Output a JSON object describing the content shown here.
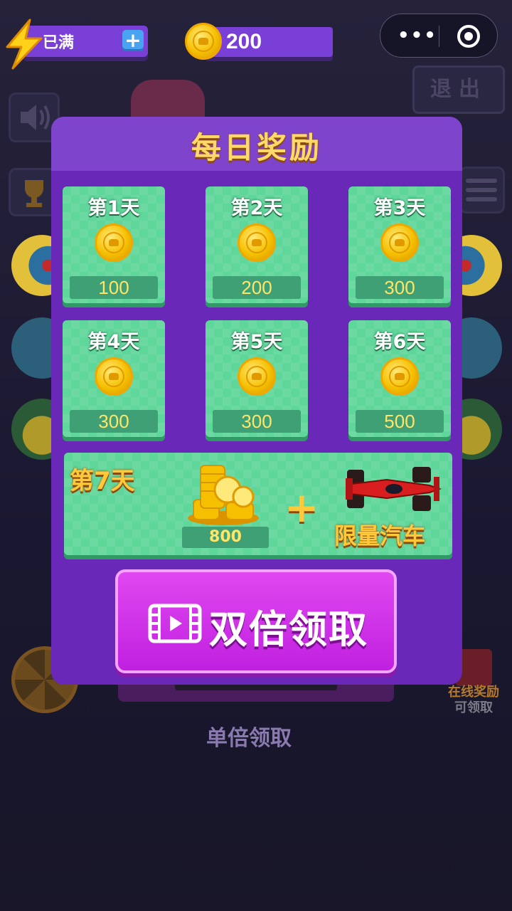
{
  "hud": {
    "energy_status": "已满",
    "energy_add_symbol": "+",
    "coin_balance": "200"
  },
  "miniprogram_menu": {
    "more_icon": "more-dots-icon",
    "close_icon": "target-close-icon"
  },
  "exit_label": "退出",
  "daily_reward": {
    "title": "每日奖励",
    "days": [
      {
        "label": "第1天",
        "amount": "100"
      },
      {
        "label": "第2天",
        "amount": "200"
      },
      {
        "label": "第3天",
        "amount": "300"
      },
      {
        "label": "第4天",
        "amount": "300"
      },
      {
        "label": "第5天",
        "amount": "300"
      },
      {
        "label": "第6天",
        "amount": "500"
      }
    ],
    "day7": {
      "label": "第7天",
      "amount": "800",
      "plus": "+",
      "extra_reward": "限量汽车"
    },
    "double_claim_label": "双倍领取",
    "single_claim_label": "单倍领取"
  },
  "online_reward": {
    "title": "在线奖励",
    "status": "可领取"
  },
  "colors": {
    "panel": "#6a28b8",
    "card": "#5fd69a",
    "button": "#d236ea",
    "title_gold": "#ffd86a"
  }
}
